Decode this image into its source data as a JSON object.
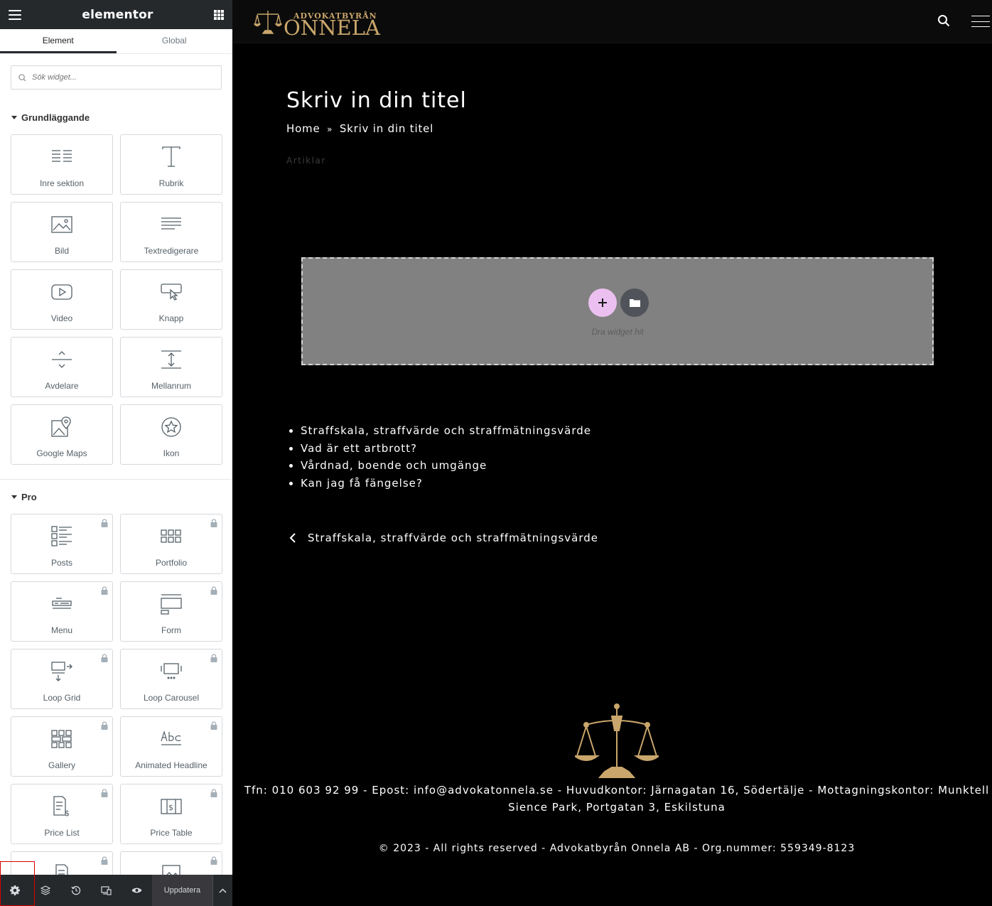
{
  "panel": {
    "brand": "elementor",
    "tabs": [
      {
        "label": "Element"
      },
      {
        "label": "Global"
      }
    ],
    "search": {
      "placeholder": "Sök widget..."
    },
    "categories": [
      {
        "title": "Grundläggande"
      },
      {
        "title": "Pro"
      }
    ],
    "basic_widgets": [
      {
        "label": "Inre sektion"
      },
      {
        "label": "Rubrik"
      },
      {
        "label": "Bild"
      },
      {
        "label": "Textredigerare"
      },
      {
        "label": "Video"
      },
      {
        "label": "Knapp"
      },
      {
        "label": "Avdelare"
      },
      {
        "label": "Mellanrum"
      },
      {
        "label": "Google Maps"
      },
      {
        "label": "Ikon"
      }
    ],
    "pro_widgets": [
      {
        "label": "Posts"
      },
      {
        "label": "Portfolio"
      },
      {
        "label": "Menu"
      },
      {
        "label": "Form"
      },
      {
        "label": "Loop Grid"
      },
      {
        "label": "Loop Carousel"
      },
      {
        "label": "Gallery"
      },
      {
        "label": "Animated Headline"
      },
      {
        "label": "Price List"
      },
      {
        "label": "Price Table"
      }
    ],
    "footer": {
      "update_label": "Uppdatera"
    }
  },
  "site": {
    "logo_top": "ADVOKATBYRÅN",
    "logo_main": "ONNELA",
    "page_title": "Skriv in din titel",
    "breadcrumb": {
      "home": "Home",
      "sep": "»",
      "current": "Skriv in din titel"
    },
    "category": "Artiklar",
    "dropzone_text": "Dra widget hit",
    "links": [
      "Straffskala, straffvärde och straffmätningsvärde",
      "Vad är ett artbrott?",
      "Vårdnad, boende och umgänge",
      "Kan jag få fängelse?"
    ],
    "prev_post": "Straffskala, straffvärde och straffmätningsvärde",
    "footer_contact": "Tfn: 010 603 92 99 - Epost: info@advokatonnela.se - Huvudkontor: Järnagatan 16, Södertälje - Mottagningskontor: Munktell Sience Park, Portgatan 3, Eskilstuna",
    "footer_copy": "© 2023 - All rights reserved - Advokatbyrån Onnela AB - Org.nummer: 559349-8123"
  },
  "colors": {
    "panel_dark": "#26292c",
    "gold": "#c9a66b",
    "dropzone": "#818181",
    "add_button": "#ebc0f0"
  }
}
